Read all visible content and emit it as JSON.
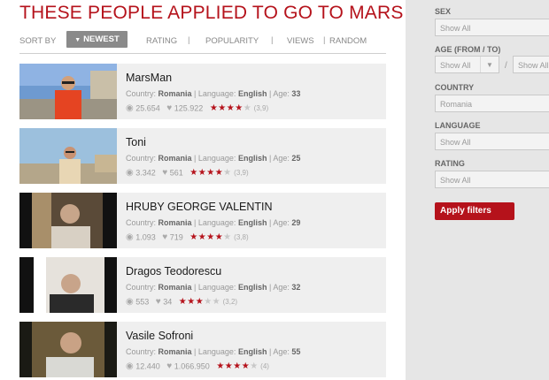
{
  "page": {
    "title": "THESE PEOPLE APPLIED TO GO TO MARS"
  },
  "sort": {
    "label": "SORT BY",
    "active": "NEWEST",
    "options": [
      "RATING",
      "POPULARITY",
      "VIEWS",
      "RANDOM"
    ],
    "separator": "|"
  },
  "applicants": [
    {
      "name": "MarsMan",
      "country_label": "Country:",
      "country": "Romania",
      "language_label": "Language:",
      "language": "English",
      "age_label": "Age:",
      "age": "33",
      "views": "25.654",
      "likes": "125.922",
      "stars": 4,
      "rating": "(3,9)"
    },
    {
      "name": "Toni",
      "country_label": "Country:",
      "country": "Romania",
      "language_label": "Language:",
      "language": "English",
      "age_label": "Age:",
      "age": "25",
      "views": "3.342",
      "likes": "561",
      "stars": 4,
      "rating": "(3,9)"
    },
    {
      "name": "HRUBY GEORGE VALENTIN",
      "country_label": "Country:",
      "country": "Romania",
      "language_label": "Language:",
      "language": "English",
      "age_label": "Age:",
      "age": "29",
      "views": "1.093",
      "likes": "719",
      "stars": 4,
      "rating": "(3,8)"
    },
    {
      "name": "Dragos Teodorescu",
      "country_label": "Country:",
      "country": "Romania",
      "language_label": "Language:",
      "language": "English",
      "age_label": "Age:",
      "age": "32",
      "views": "553",
      "likes": "34",
      "stars": 3,
      "rating": "(3,2)"
    },
    {
      "name": "Vasile Sofroni",
      "country_label": "Country:",
      "country": "Romania",
      "language_label": "Language:",
      "language": "English",
      "age_label": "Age:",
      "age": "55",
      "views": "12.440",
      "likes": "1.066.950",
      "stars": 4,
      "rating": "(4)"
    }
  ],
  "filters": {
    "sex": {
      "label": "SEX",
      "value": "Show All"
    },
    "age": {
      "label": "AGE (FROM / TO)",
      "from": "Show All",
      "to": "Show All",
      "separator": "/"
    },
    "country": {
      "label": "COUNTRY",
      "value": "Romania"
    },
    "language": {
      "label": "LANGUAGE",
      "value": "Show All"
    },
    "rating": {
      "label": "RATING",
      "value": "Show All"
    },
    "apply_label": "Apply filters"
  },
  "colors": {
    "accent": "#b5121b",
    "card_bg": "#efefef",
    "sidebar_bg": "#e6e6e6"
  },
  "icons": {
    "views": "eye-icon",
    "likes": "heart-icon",
    "star": "star-icon",
    "dropdown": "chevron-down-icon"
  }
}
